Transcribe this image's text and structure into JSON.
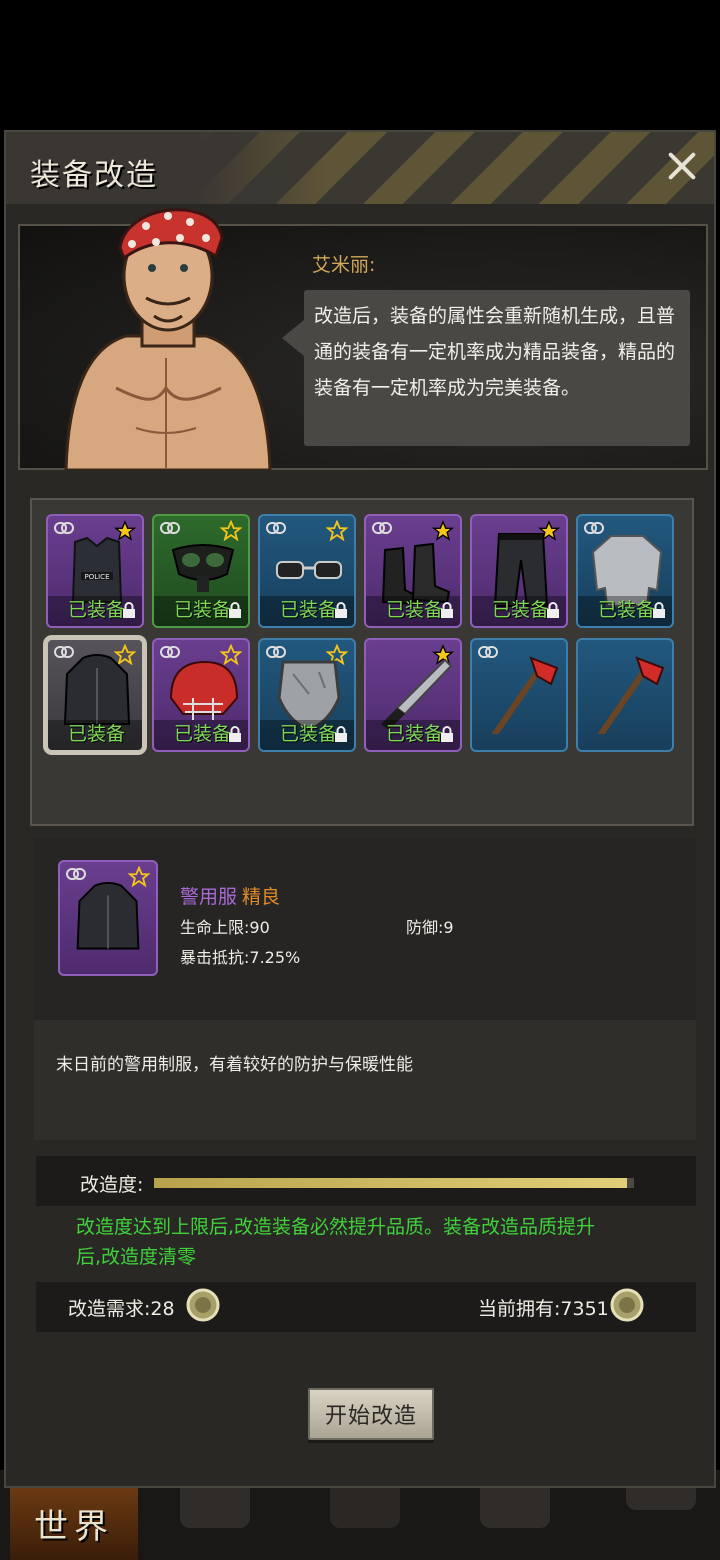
{
  "dialog": {
    "title": "装备改造",
    "close_icon": "close-icon"
  },
  "npc": {
    "name": "艾米丽:",
    "speech": "改造后，装备的属性会重新随机生成，且普通的装备有一定机率成为精品装备，精品的装备有一定机率成为完美装备。"
  },
  "equipment": [
    {
      "item": "police-vest",
      "rarity": "purple",
      "star": "filled",
      "equipped": "已装备",
      "locked": true
    },
    {
      "item": "gas-mask",
      "rarity": "green",
      "star": "outline",
      "equipped": "已装备",
      "locked": true
    },
    {
      "item": "goggles",
      "rarity": "blue",
      "star": "outline",
      "equipped": "已装备",
      "locked": true
    },
    {
      "item": "boots",
      "rarity": "purple",
      "star": "filled",
      "equipped": "已装备",
      "locked": true
    },
    {
      "item": "pants",
      "rarity": "purple",
      "star": "filled",
      "equipped": "已装备",
      "locked": true
    },
    {
      "item": "long-sleeve-shirt",
      "rarity": "blue",
      "star": "none",
      "equipped": "已装备",
      "locked": true
    },
    {
      "item": "police-jacket",
      "rarity": "purple",
      "star": "outline",
      "equipped": "已装备",
      "locked": false,
      "selected": true
    },
    {
      "item": "football-helmet",
      "rarity": "purple",
      "star": "outline",
      "equipped": "已装备",
      "locked": true
    },
    {
      "item": "shield",
      "rarity": "blue",
      "star": "outline",
      "equipped": "已装备",
      "locked": true
    },
    {
      "item": "machete",
      "rarity": "purple",
      "star": "filled",
      "equipped": "已装备",
      "locked": true
    },
    {
      "item": "fire-axe",
      "rarity": "blue",
      "star": "none",
      "equipped": "",
      "locked": false
    },
    {
      "item": "fire-axe",
      "rarity": "blue",
      "star": "none",
      "equipped": "",
      "locked": false
    }
  ],
  "detail": {
    "name": "警用服",
    "quality": "精良",
    "stat_hp": "生命上限:90",
    "stat_def": "防御:9",
    "stat_crit": "暴击抵抗:7.25%",
    "description": "末日前的警用制服，有着较好的防护与保暖性能"
  },
  "progress": {
    "label": "改造度:",
    "value_fraction": 0.985,
    "color": "#d6c46a"
  },
  "notice": "改造度达到上限后,改造装备必然提升品质。装备改造品质提升后,改造度清零",
  "cost": {
    "need": "改造需求:28",
    "own": "当前拥有:7351"
  },
  "start_button": "开始改造",
  "bottom_nav": {
    "world": "世界"
  },
  "colors": {
    "equipped_green": "#7ed957",
    "purple_item": "#a86ad4",
    "quality_orange": "#e08a2a",
    "notice_green": "#3fd23a"
  }
}
